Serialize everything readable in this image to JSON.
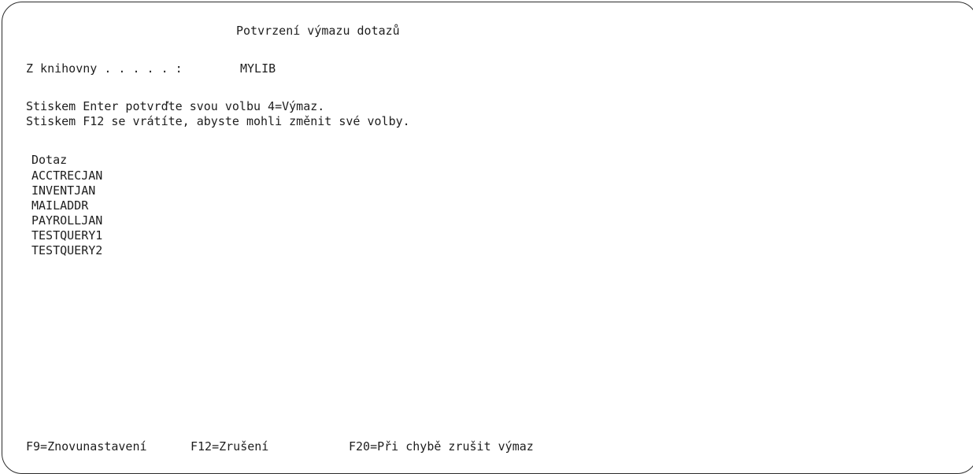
{
  "screen": {
    "title": "Potvrzení výmazu dotazů",
    "library_label": "Z knihovny . . . . . :",
    "library_value": "MYLIB",
    "instruction_1": "Stiskem Enter potvrďte svou volbu 4=Výmaz.",
    "instruction_2": "Stiskem F12 se vrátíte, abyste mohli změnit své volby.",
    "column_header": "Dotaz",
    "queries": [
      "ACCTRECJAN",
      "INVENTJAN",
      "MAILADDR",
      "PAYROLLJAN",
      "TESTQUERY1",
      "TESTQUERY2"
    ]
  },
  "function_keys": {
    "f9": "F9=Znovunastavení",
    "f12": "F12=Zrušení",
    "f20": "F20=Při chybě zrušit výmaz"
  }
}
